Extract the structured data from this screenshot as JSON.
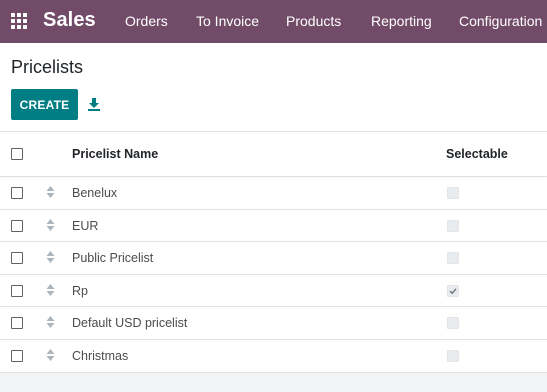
{
  "navbar": {
    "brand": "Sales",
    "items": [
      "Orders",
      "To Invoice",
      "Products",
      "Reporting",
      "Configuration"
    ]
  },
  "page": {
    "title": "Pricelists",
    "create_label": "CREATE"
  },
  "table": {
    "columns": [
      "Pricelist Name",
      "Selectable"
    ],
    "rows": [
      {
        "name": "Benelux",
        "selectable": false
      },
      {
        "name": "EUR",
        "selectable": false
      },
      {
        "name": "Public Pricelist",
        "selectable": false
      },
      {
        "name": "Rp",
        "selectable": true
      },
      {
        "name": "Default USD pricelist",
        "selectable": false
      },
      {
        "name": "Christmas",
        "selectable": false
      }
    ]
  },
  "colors": {
    "navbar": "#714b67",
    "primary_button": "#017e84"
  },
  "icons": {
    "apps": "grid-icon",
    "download": "download-icon",
    "drag": "drag-handle-icon"
  }
}
